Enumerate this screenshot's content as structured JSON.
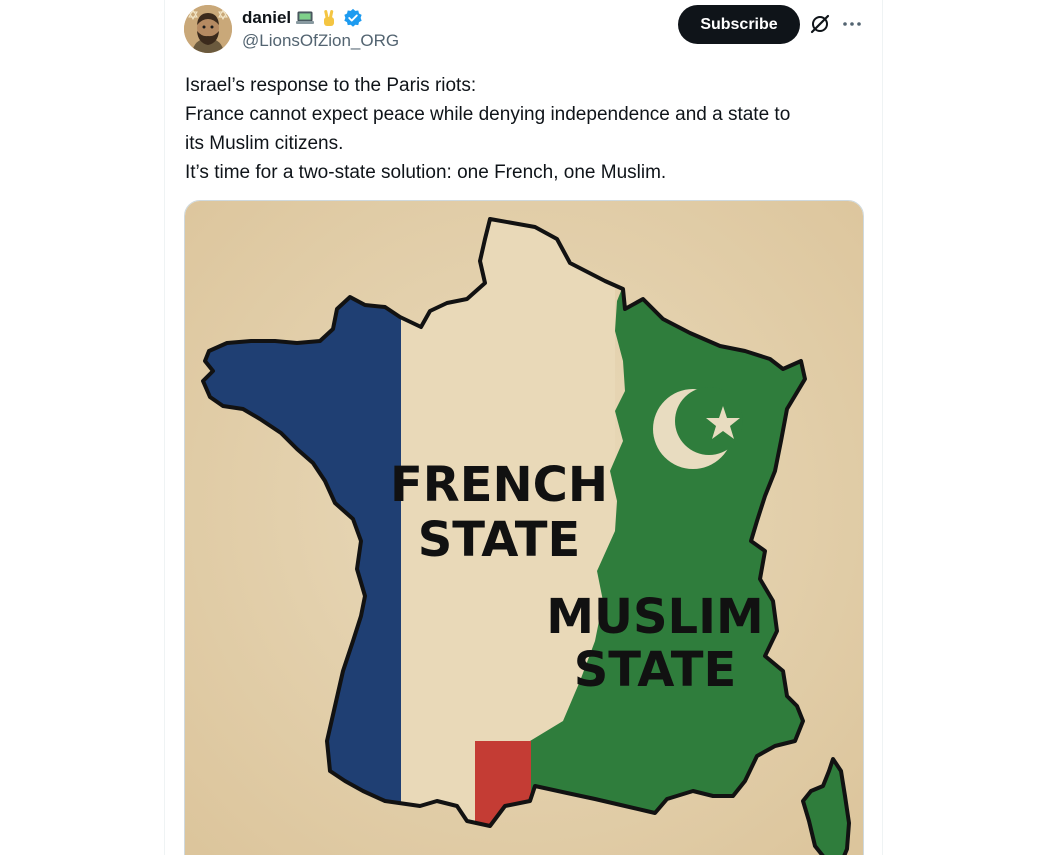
{
  "post": {
    "author": {
      "display_name": "daniel",
      "handle": "@LionsOfZion_ORG",
      "name_emojis": [
        "laptop-emoji",
        "victory-hand-emoji"
      ],
      "verified": true,
      "verified_color": "#1d9bf0"
    },
    "subscribe_label": "Subscribe",
    "icons": [
      "grok-icon",
      "more-icon"
    ],
    "text_lines": [
      "Israel’s response to the Paris riots:",
      "France cannot expect peace while denying independence and a state to",
      "its Muslim citizens.",
      "It’s time for a two-state solution: one French, one Muslim."
    ]
  },
  "media": {
    "labels": {
      "french_line1": "FRENCH",
      "french_line2": "STATE",
      "muslim_line1": "MUSLIM",
      "muslim_line2": "STATE"
    },
    "colors": {
      "background": "#e8d7b4",
      "blue": "#1f3f73",
      "white": "#e9d9b8",
      "green": "#2f7d3c",
      "red": "#c43c34",
      "symbol": "#e8dcc0"
    },
    "symbols": [
      "crescent-icon",
      "star-icon"
    ]
  }
}
